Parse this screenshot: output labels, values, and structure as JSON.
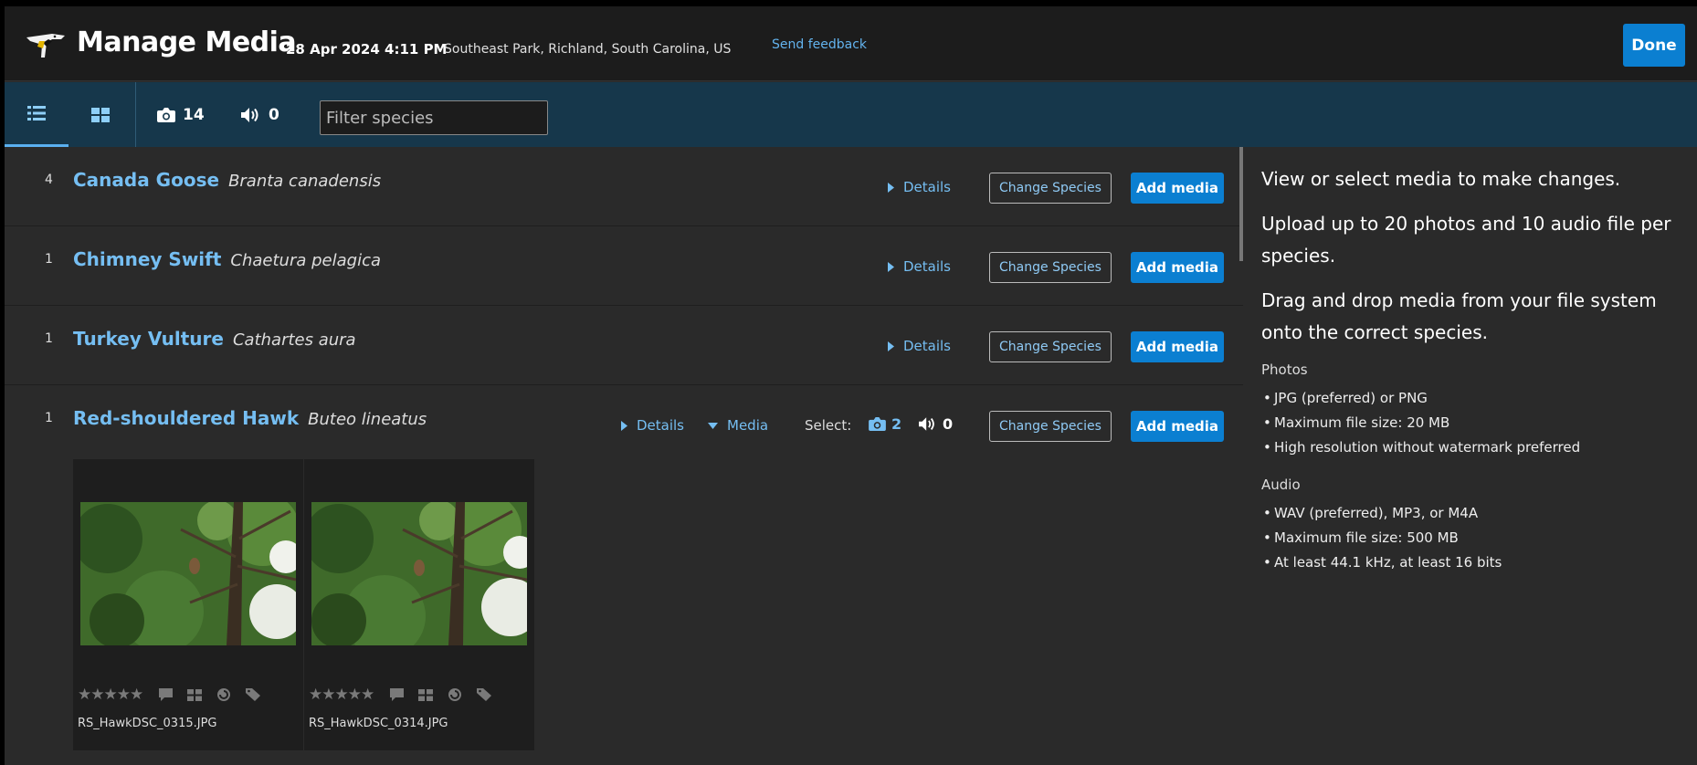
{
  "header": {
    "title": "Manage Media",
    "date": "28 Apr 2024 4:11 PM",
    "location": "Southeast Park, Richland, South Carolina, US",
    "feedback": "Send feedback",
    "done_label": "Done"
  },
  "toolbar": {
    "photo_count": "14",
    "audio_count": "0",
    "filter_placeholder": "Filter species",
    "active_view": "list"
  },
  "species": [
    {
      "count": "4",
      "common": "Canada Goose",
      "scientific": "Branta canadensis",
      "details_label": "Details",
      "change_label": "Change Species",
      "add_label": "Add media"
    },
    {
      "count": "1",
      "common": "Chimney Swift",
      "scientific": "Chaetura pelagica",
      "details_label": "Details",
      "change_label": "Change Species",
      "add_label": "Add media"
    },
    {
      "count": "1",
      "common": "Turkey Vulture",
      "scientific": "Cathartes aura",
      "details_label": "Details",
      "change_label": "Change Species",
      "add_label": "Add media"
    },
    {
      "count": "1",
      "common": "Red-shouldered Hawk",
      "scientific": "Buteo lineatus",
      "details_label": "Details",
      "media_label": "Media",
      "select_label": "Select:",
      "select_photo_count": "2",
      "select_audio_count": "0",
      "change_label": "Change Species",
      "add_label": "Add media",
      "media": [
        {
          "filename": "RS_HawkDSC_0315.JPG",
          "stars": "★★★★★"
        },
        {
          "filename": "RS_HawkDSC_0314.JPG",
          "stars": "★★★★★"
        }
      ]
    }
  ],
  "panel": {
    "intro": "View or select media to make changes.",
    "upload": "Upload up to 20 photos and 10 audio file per species.",
    "drag": "Drag and drop media from your file system onto the correct species.",
    "photos_heading": "Photos",
    "photos_items": [
      "JPG (preferred) or PNG",
      "Maximum file size: 20 MB",
      "High resolution without watermark preferred"
    ],
    "audio_heading": "Audio",
    "audio_items": [
      "WAV (preferred), MP3, or M4A",
      "Maximum file size: 500 MB",
      "At least 44.1 kHz, at least 16 bits"
    ]
  },
  "colors": {
    "accent": "#0b7fd1",
    "link": "#75bef2",
    "toolbar": "#16374b",
    "header": "#1c1c1c",
    "background": "#2a2a2a"
  }
}
